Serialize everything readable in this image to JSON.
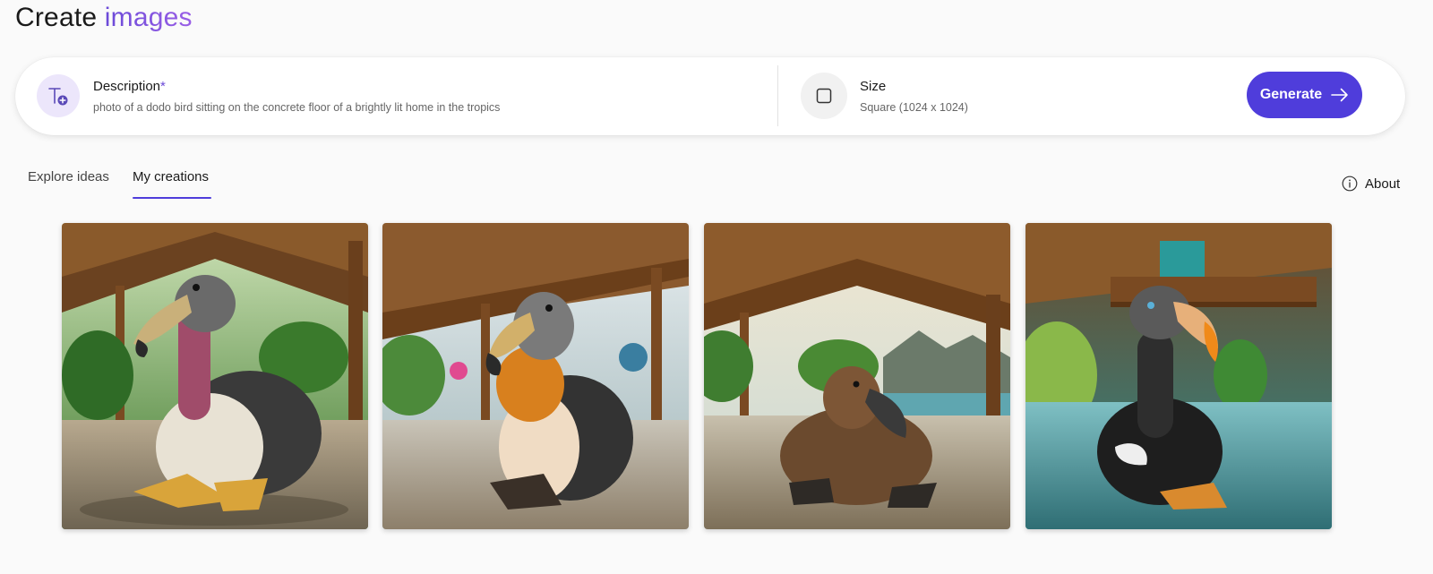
{
  "header": {
    "title_main": "Create",
    "title_accent": "images"
  },
  "prompt": {
    "description_label": "Description",
    "description_required": "*",
    "description_value": "photo of a dodo bird sitting on the concrete floor of a brightly lit home in the tropics",
    "size_label": "Size",
    "size_value": "Square (1024 x 1024)",
    "generate_label": "Generate",
    "accent_color": "#4f3ddb"
  },
  "tabs": [
    {
      "label": "Explore ideas",
      "active": false
    },
    {
      "label": "My creations",
      "active": true
    }
  ],
  "about_label": "About",
  "icons": {
    "description": "text-add-icon",
    "size": "square-icon",
    "generate": "arrow-right-icon",
    "about": "info-icon"
  }
}
